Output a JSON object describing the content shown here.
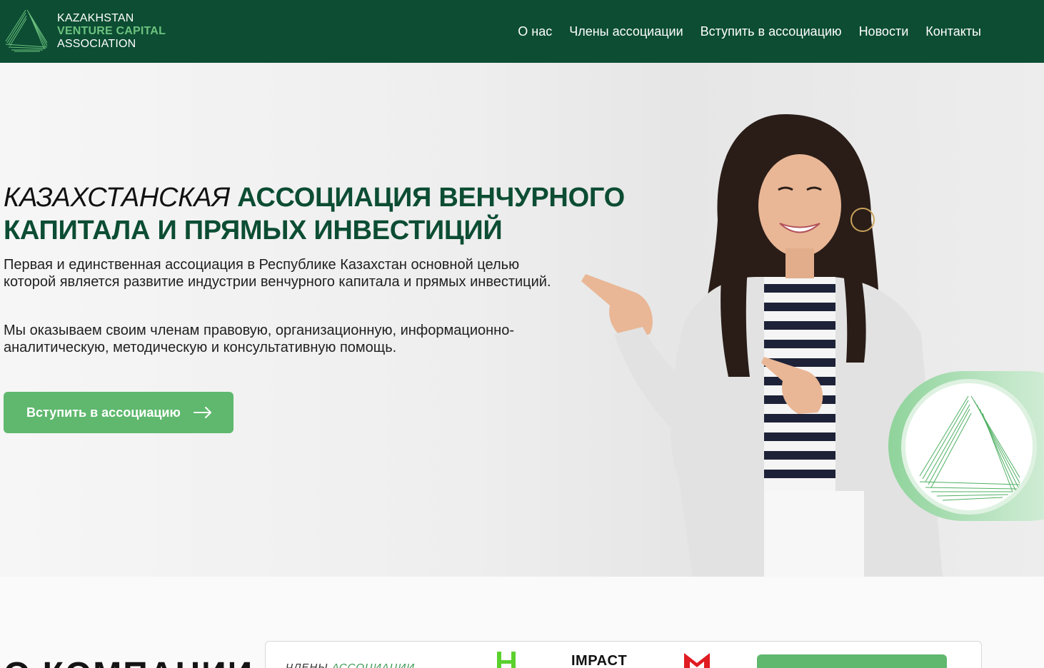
{
  "header": {
    "logo": {
      "line1": "KAZAKHSTAN",
      "line2": "VENTURE CAPITAL",
      "line3": "ASSOCIATION"
    },
    "nav": [
      {
        "label": "О нас"
      },
      {
        "label": "Члены ассоциации"
      },
      {
        "label": "Вступить в ассоциацию"
      },
      {
        "label": "Новости"
      },
      {
        "label": "Контакты"
      }
    ]
  },
  "hero": {
    "title_accent": "КАЗАХСТАНСКАЯ",
    "title_rest": "АССОЦИАЦИЯ ВЕНЧУРНОГО КАПИТАЛА И ПРЯМЫХ ИНВЕСТИЦИЙ",
    "paragraph1": "Первая и единственная ассоциация в Республике Казахстан основной целью которой является развитие индустрии венчурного капитала и прямых инвестиций.",
    "paragraph2": "Мы оказываем своим членам правовую, организационную, информационно-аналитическую, методическую и консультативную помощь.",
    "cta_label": "Вступить в ассоциацию"
  },
  "about": {
    "title": "О КОМПАНИИ",
    "members_label_1": "ЧЛЕНЫ",
    "members_label_2": "АССОЦИАЦИИ",
    "member_logos": [
      "IMPACT"
    ]
  },
  "colors": {
    "header_bg": "#0c4d33",
    "accent_green": "#5fb86e",
    "title_green": "#0c4d33"
  }
}
